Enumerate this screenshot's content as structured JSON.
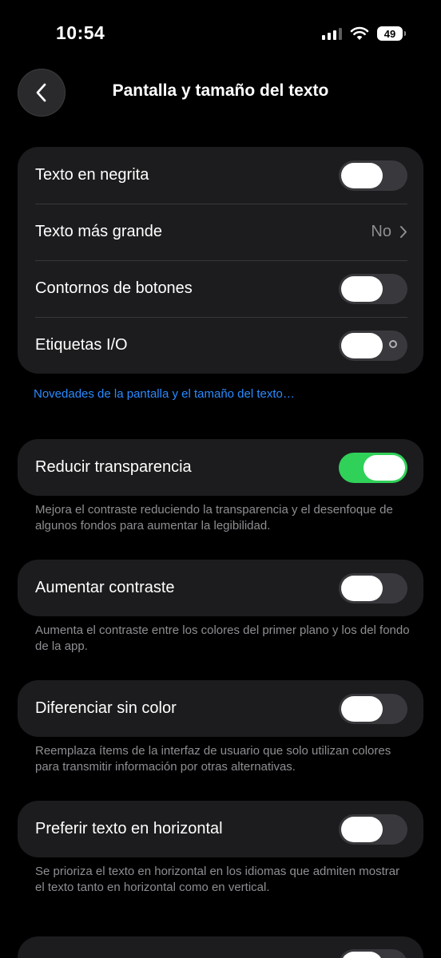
{
  "status": {
    "time": "10:54",
    "battery": "49"
  },
  "nav": {
    "title": "Pantalla y tamaño del texto"
  },
  "group1": {
    "bold_text": {
      "label": "Texto en negrita",
      "on": false
    },
    "larger_text": {
      "label": "Texto más grande",
      "value": "No"
    },
    "button_shapes": {
      "label": "Contornos de botones",
      "on": false
    },
    "on_off_labels": {
      "label": "Etiquetas I/O",
      "on": false
    }
  },
  "link": "Novedades de la pantalla y el tamaño del texto…",
  "reduce_transparency": {
    "label": "Reducir transparencia",
    "on": true,
    "footnote": "Mejora el contraste reduciendo la transparencia y el desenfoque de algunos fondos para aumentar la legibilidad."
  },
  "increase_contrast": {
    "label": "Aumentar contraste",
    "on": false,
    "footnote": "Aumenta el contraste entre los colores del primer plano y los del fondo de la app."
  },
  "differentiate_without_color": {
    "label": "Diferenciar sin color",
    "on": false,
    "footnote": "Reemplaza ítems de la interfaz de usuario que solo utilizan colores para transmitir información por otras alternativas."
  },
  "prefer_horizontal_text": {
    "label": "Preferir texto en horizontal",
    "on": false,
    "footnote": "Se prioriza el texto en horizontal en los idiomas que admiten mostrar el texto tanto en horizontal como en vertical."
  },
  "colors": {
    "background": "#000000",
    "cell": "#1c1c1e",
    "toggle_on": "#30d158",
    "toggle_off": "#39393d",
    "link": "#2b8bff",
    "secondary_text": "#8e8e93"
  },
  "icons": {
    "back": "chevron-left-icon",
    "disclosure": "chevron-right-icon",
    "wifi": "wifi-icon",
    "signal": "cellular-signal-icon",
    "battery": "battery-icon"
  }
}
